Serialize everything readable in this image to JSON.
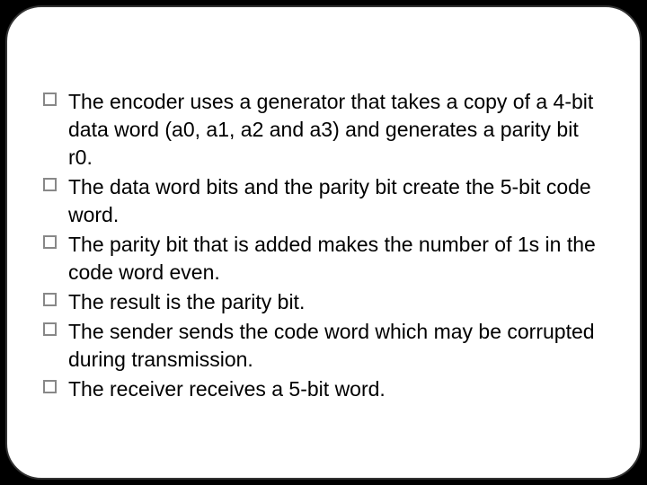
{
  "bullets": [
    "The encoder uses a generator that takes a copy of a 4-bit data word (a0, a1, a2 and a3) and generates a parity bit r0.",
    "The data word bits and the parity bit create the 5-bit code word.",
    "The parity bit that is added makes the number of 1s in the code word even.",
    "The result is the parity bit.",
    "The sender sends the code word which may be corrupted during transmission.",
    "The receiver receives a 5-bit word."
  ]
}
